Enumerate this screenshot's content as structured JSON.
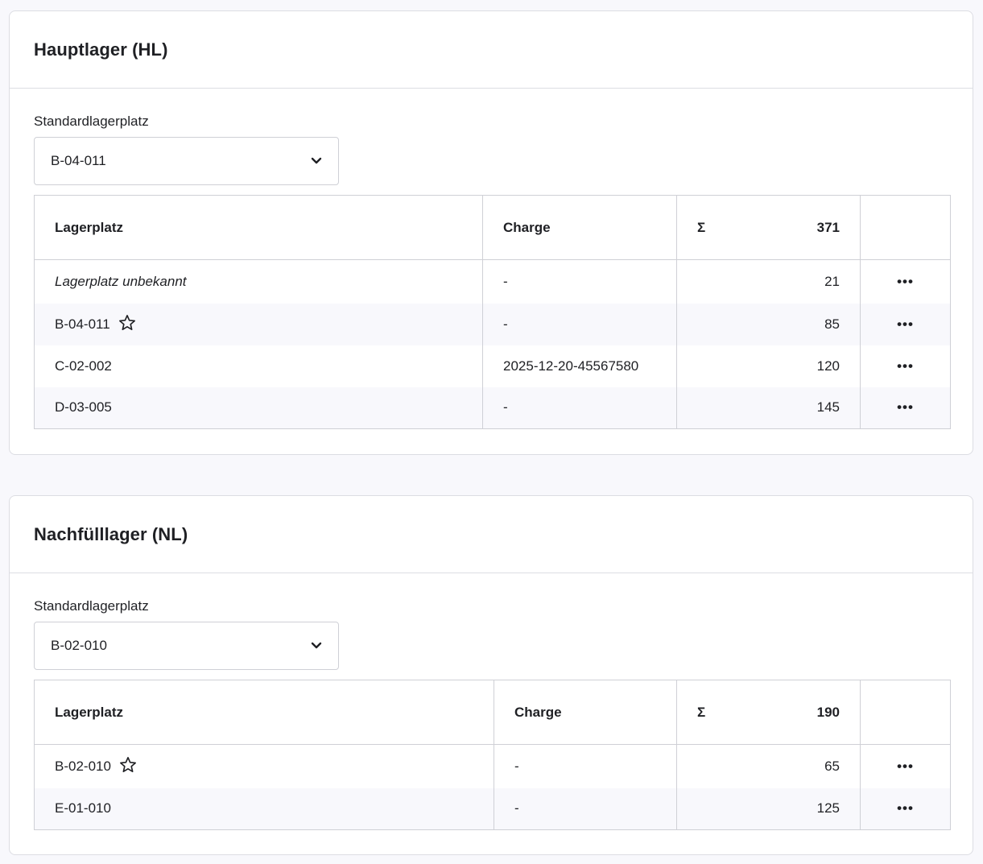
{
  "warehouses": [
    {
      "title": "Hauptlager (HL)",
      "default_label": "Standardlagerplatz",
      "default_value": "B-04-011",
      "columns": {
        "location": "Lagerplatz",
        "charge": "Charge",
        "sum_symbol": "Σ",
        "sum_value": "371"
      },
      "rows": [
        {
          "location": "Lagerplatz unbekannt",
          "charge": "-",
          "qty": "21",
          "italic": true,
          "favorite": false
        },
        {
          "location": "B-04-011",
          "charge": "-",
          "qty": "85",
          "italic": false,
          "favorite": true
        },
        {
          "location": "C-02-002",
          "charge": "2025-12-20-45567580",
          "qty": "120",
          "italic": false,
          "favorite": false
        },
        {
          "location": "D-03-005",
          "charge": "-",
          "qty": "145",
          "italic": false,
          "favorite": false
        }
      ]
    },
    {
      "title": "Nachfülllager (NL)",
      "default_label": "Standardlagerplatz",
      "default_value": "B-02-010",
      "columns": {
        "location": "Lagerplatz",
        "charge": "Charge",
        "sum_symbol": "Σ",
        "sum_value": "190"
      },
      "rows": [
        {
          "location": "B-02-010",
          "charge": "-",
          "qty": "65",
          "italic": false,
          "favorite": true
        },
        {
          "location": "E-01-010",
          "charge": "-",
          "qty": "125",
          "italic": false,
          "favorite": false
        }
      ]
    }
  ],
  "icons": {
    "dropdown": "chevron-down-icon",
    "favorite": "star-icon",
    "row_menu": "more-horizontal-icon"
  },
  "menu_glyph": "•••"
}
